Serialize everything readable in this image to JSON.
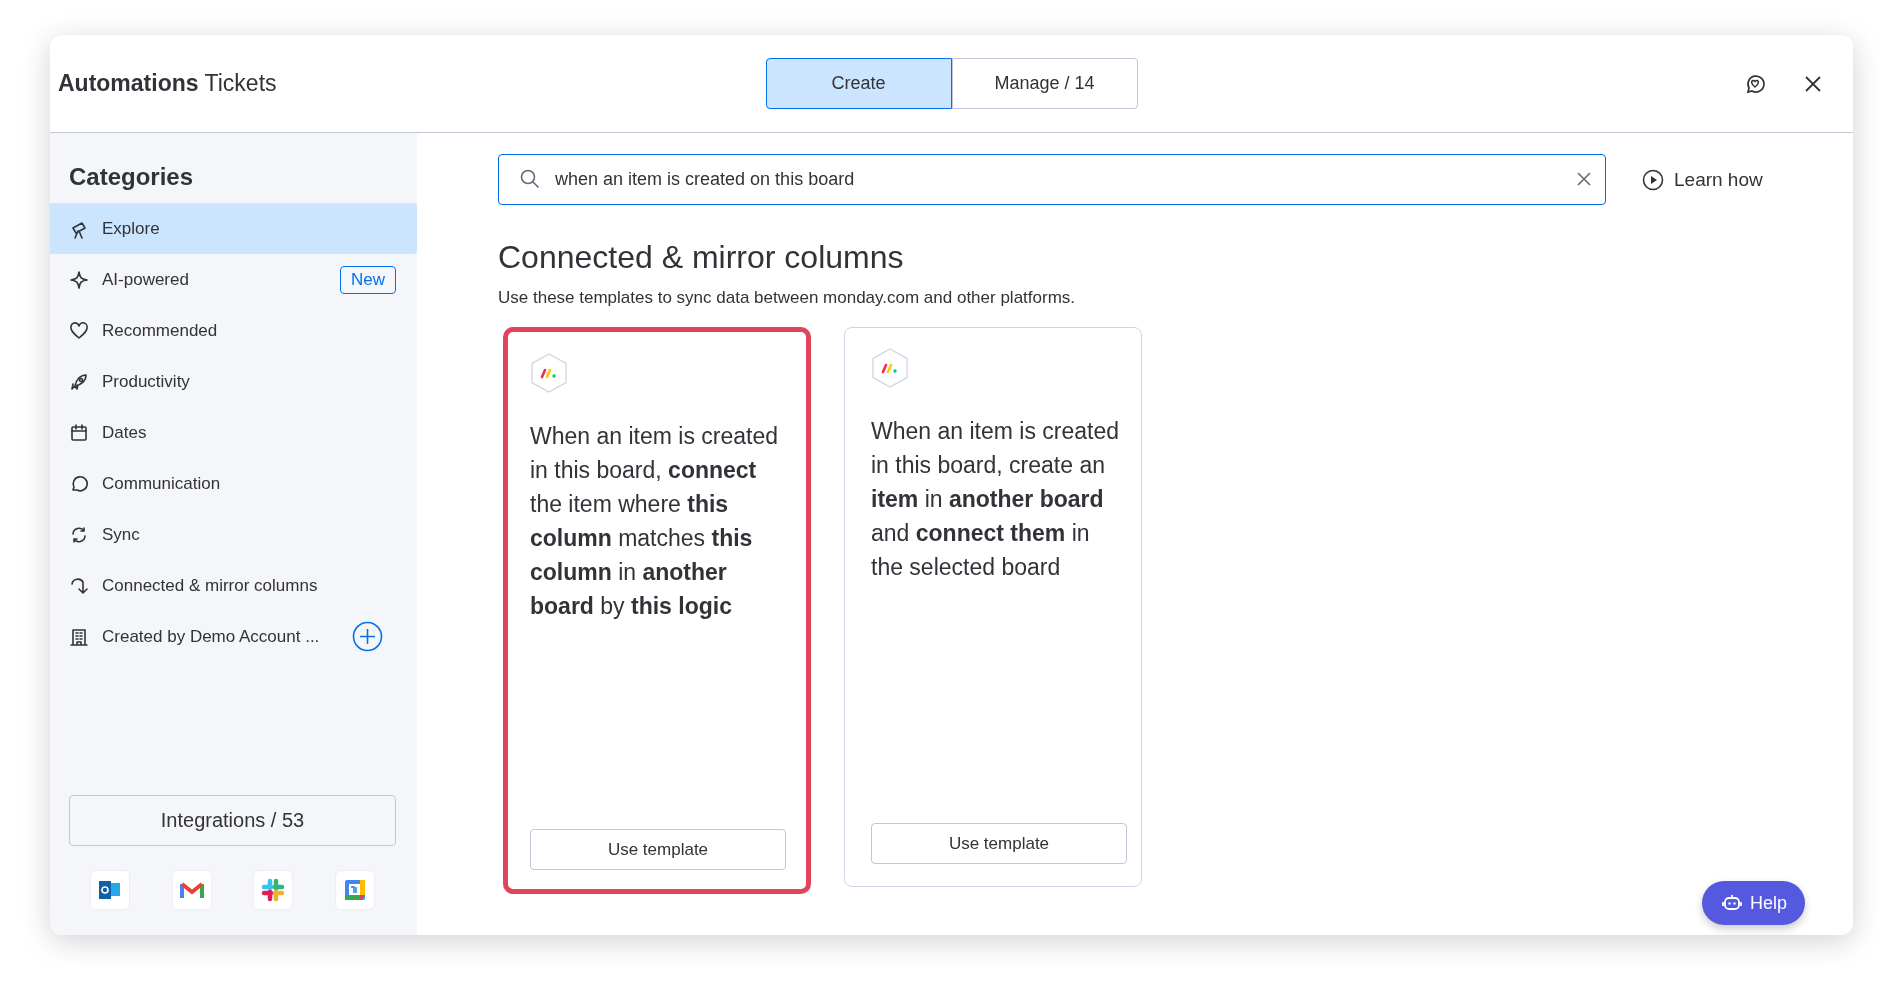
{
  "header": {
    "title": "**Automations** Tickets"
  },
  "tabs": [
    {
      "label": "Create",
      "selected": true
    },
    {
      "label": "Manage / 14",
      "selected": false
    }
  ],
  "sidebar": {
    "heading": "Categories",
    "items": [
      {
        "kind": "link",
        "label": "Explore",
        "selected": true
      },
      {
        "kind": "badge",
        "label": "AI-powered",
        "badge": "New",
        "selected": false
      },
      {
        "kind": "link",
        "label": "Recommended",
        "selected": false
      },
      {
        "kind": "link",
        "label": "Productivity",
        "selected": false
      },
      {
        "kind": "link",
        "label": "Dates",
        "selected": false
      },
      {
        "kind": "link",
        "label": "Communication",
        "selected": false
      },
      {
        "kind": "link",
        "label": "Sync",
        "selected": false
      },
      {
        "kind": "link",
        "label": "Connected & mirror columns",
        "selected": false
      },
      {
        "kind": "add",
        "label": "Created by Demo Account ...",
        "selected": false
      }
    ],
    "integrations_button": "Integrations / 53"
  },
  "search": {
    "value": "when an item is created on this board"
  },
  "learn_how": "Learn how",
  "section": {
    "title": "Connected & mirror columns",
    "subtitle": "Use these templates to sync data between monday.com and other platforms."
  },
  "templates": [
    {
      "text": "When an item is created in this board, **connect** the item where **this column** matches **this column** in **another board** by **this logic**",
      "button": "Use template",
      "selected": true
    },
    {
      "text": "When an item is created in this board, create an **item** in **another board** and **connect them** in the selected board",
      "button": "Use template",
      "selected": false
    }
  ],
  "help": "Help"
}
